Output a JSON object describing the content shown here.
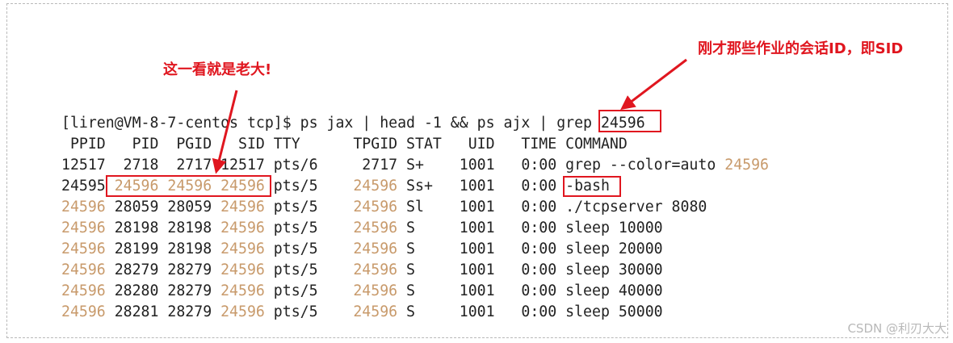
{
  "terminal": {
    "command_prompt": "[liren@VM-8-7-centos tcp]$ ps jax | head -1 && ps ajx | grep ",
    "command_arg": "24596",
    "header": " PPID   PID  PGID   SID TTY      TPGID STAT   UID   TIME COMMAND",
    "rows": [
      [
        {
          "t": "12517  2718  2717 12517 pts/6     2717 S+    1001   0:00 grep --color=auto "
        },
        {
          "t": "24596",
          "h": true
        }
      ],
      [
        {
          "t": "24595 "
        },
        {
          "t": "24596",
          "h": true
        },
        {
          "t": " "
        },
        {
          "t": "24596",
          "h": true
        },
        {
          "t": " "
        },
        {
          "t": "24596",
          "h": true
        },
        {
          "t": " pts/5    "
        },
        {
          "t": "24596",
          "h": true
        },
        {
          "t": " Ss+   1001   0:00 -bash"
        }
      ],
      [
        {
          "t": "24596",
          "h": true
        },
        {
          "t": " 28059 28059 "
        },
        {
          "t": "24596",
          "h": true
        },
        {
          "t": " pts/5    "
        },
        {
          "t": "24596",
          "h": true
        },
        {
          "t": " Sl    1001   0:00 ./tcpserver 8080"
        }
      ],
      [
        {
          "t": "24596",
          "h": true
        },
        {
          "t": " 28198 28198 "
        },
        {
          "t": "24596",
          "h": true
        },
        {
          "t": " pts/5    "
        },
        {
          "t": "24596",
          "h": true
        },
        {
          "t": " S     1001   0:00 sleep 10000"
        }
      ],
      [
        {
          "t": "24596",
          "h": true
        },
        {
          "t": " 28199 28198 "
        },
        {
          "t": "24596",
          "h": true
        },
        {
          "t": " pts/5    "
        },
        {
          "t": "24596",
          "h": true
        },
        {
          "t": " S     1001   0:00 sleep 20000"
        }
      ],
      [
        {
          "t": "24596",
          "h": true
        },
        {
          "t": " 28279 28279 "
        },
        {
          "t": "24596",
          "h": true
        },
        {
          "t": " pts/5    "
        },
        {
          "t": "24596",
          "h": true
        },
        {
          "t": " S     1001   0:00 sleep 30000"
        }
      ],
      [
        {
          "t": "24596",
          "h": true
        },
        {
          "t": " 28280 28279 "
        },
        {
          "t": "24596",
          "h": true
        },
        {
          "t": " pts/5    "
        },
        {
          "t": "24596",
          "h": true
        },
        {
          "t": " S     1001   0:00 sleep 40000"
        }
      ],
      [
        {
          "t": "24596",
          "h": true
        },
        {
          "t": " 28281 28279 "
        },
        {
          "t": "24596",
          "h": true
        },
        {
          "t": " pts/5    "
        },
        {
          "t": "24596",
          "h": true
        },
        {
          "t": " S     1001   0:00 sleep 50000"
        }
      ]
    ]
  },
  "annotations": {
    "leader_note": "这一看就是老大!",
    "sid_note": "刚才那些作业的会话ID，即SID"
  },
  "watermark": "CSDN @利刃大大",
  "colors": {
    "annotation": "#e0161f",
    "highlight": "#c89a6b",
    "text": "#222222"
  }
}
